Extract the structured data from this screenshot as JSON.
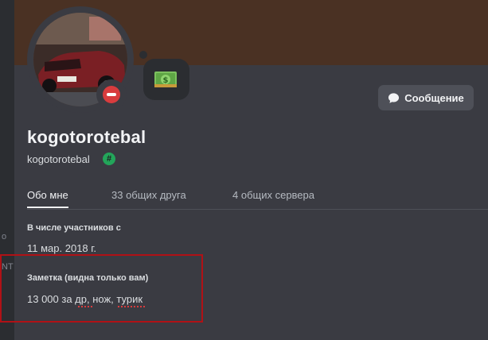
{
  "profile": {
    "display_name": "kogotorotebal",
    "username": "kogotorotebal",
    "badge_symbol": "#",
    "status": "do-not-disturb",
    "custom_status_emoji": "money-bill-emoji"
  },
  "actions": {
    "message_label": "Сообщение",
    "message_icon": "speech-bubble-icon"
  },
  "tabs": [
    {
      "label": "Обо мне",
      "active": true
    },
    {
      "label": "33 общих друга",
      "active": false
    },
    {
      "label": "4 общих сервера",
      "active": false
    }
  ],
  "about": {
    "member_since_label": "В числе участников с",
    "member_since_value": "11 мар. 2018 г.",
    "note_label": "Заметка (видна только вам)",
    "note_value": "13 000 за др, нож, турик"
  },
  "background": {
    "left_text_1": "о",
    "left_text_2": "NT"
  },
  "colors": {
    "banner": "#4a3123",
    "card": "#3a3b42",
    "status_dnd": "#d83c3e",
    "badge": "#23a55a",
    "highlight": "#b01116"
  }
}
